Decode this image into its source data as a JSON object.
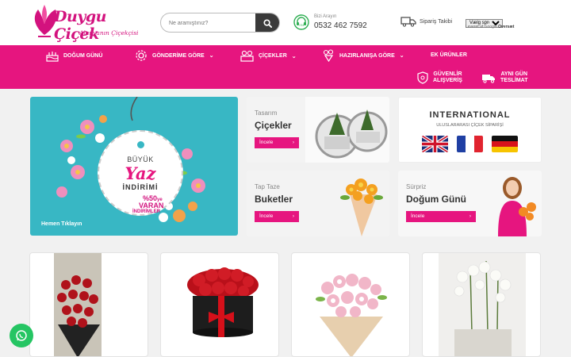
{
  "brand": {
    "name": "Duygu Çiçek",
    "tagline": "Alanyanın Çiçekçisi"
  },
  "search": {
    "placeholder": "Ne aramıştınız?"
  },
  "contact": {
    "label": "Bizi Arayın",
    "phone": "0532 462 7592"
  },
  "track": {
    "label": "Sipariş Takibi"
  },
  "language": {
    "selected": "Vælg sprog",
    "powered_prefix": "Leveret af",
    "powered_brand": "Google",
    "powered_suffix": "Oversæt"
  },
  "nav": {
    "items": [
      {
        "label": "DOĞUM GÜNÜ",
        "icon": "cake-icon"
      },
      {
        "label": "GÖNDERİME GÖRE",
        "icon": "gear-icon",
        "dropdown": true
      },
      {
        "label": "ÇİÇEKLER",
        "icon": "flowers-icon",
        "dropdown": true
      },
      {
        "label": "HAZIRLANIŞA GÖRE",
        "icon": "bouquet-icon",
        "dropdown": true
      },
      {
        "label": "EK ÜRÜNLER"
      }
    ],
    "badges": [
      {
        "line1": "GÜVENLİR",
        "line2": "ALIŞVERİŞ",
        "icon": "shield-icon"
      },
      {
        "line1": "AYNI GÜN",
        "line2": "TESLİMAT",
        "icon": "truck-icon"
      }
    ],
    "chevron": "⌄"
  },
  "banners": {
    "main": {
      "small": "BÜYÜK",
      "big": "Yaz",
      "sub": "İNDİRİMİ",
      "pct": "%50",
      "pct_suffix": "ye",
      "line2": "VARAN",
      "line3": "İNDİRİMLER",
      "cta": "Hemen Tıklayın"
    },
    "b2": {
      "small": "Tasarım",
      "big": "Çiçekler",
      "button": "İncele"
    },
    "b3": {
      "title": "INTERNATIONAL",
      "subtitle": "ULUSLARARASI ÇİÇEK SİPARİŞİ",
      "flags": [
        "uk",
        "france",
        "germany"
      ]
    },
    "b4": {
      "small": "Tap Taze",
      "big": "Buketler",
      "button": "İncele"
    },
    "b5": {
      "small": "Sürpriz",
      "big": "Doğum Günü",
      "button": "İncele"
    }
  },
  "products": [
    {
      "name": "red-roses-bouquet"
    },
    {
      "name": "red-roses-box"
    },
    {
      "name": "pink-lisianthus-bouquet"
    },
    {
      "name": "white-orchid-pot"
    }
  ],
  "colors": {
    "accent": "#e6157f",
    "teal": "#38b7c4",
    "whatsapp": "#25c563"
  },
  "arrow": "›"
}
